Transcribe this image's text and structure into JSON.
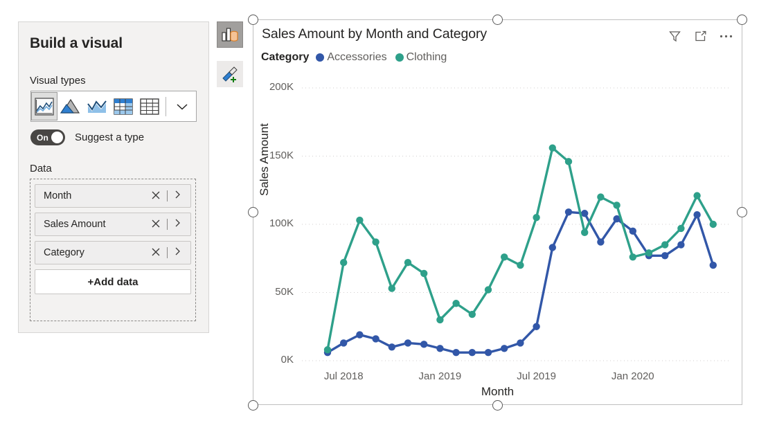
{
  "build_pane": {
    "title": "Build a visual",
    "visual_types_label": "Visual types",
    "visual_types": [
      {
        "name": "line-chart",
        "selected": true
      },
      {
        "name": "area-chart",
        "selected": false
      },
      {
        "name": "line-area-chart",
        "selected": false
      },
      {
        "name": "matrix-table",
        "selected": false
      },
      {
        "name": "table",
        "selected": false
      }
    ],
    "more_types_icon": "chevron-down-icon",
    "suggest": {
      "toggle_state": "On",
      "label": "Suggest a type"
    },
    "data_label": "Data",
    "fields": [
      {
        "name": "Month",
        "remove_icon": "close-icon",
        "expand_icon": "chevron-right-icon"
      },
      {
        "name": "Sales Amount",
        "remove_icon": "close-icon",
        "expand_icon": "chevron-right-icon"
      },
      {
        "name": "Category",
        "remove_icon": "close-icon",
        "expand_icon": "chevron-right-icon"
      }
    ],
    "add_data_label": "+Add data"
  },
  "side_buttons": [
    {
      "name": "build-visual-button",
      "icon": "bar-chart-data-icon",
      "active": true
    },
    {
      "name": "format-visual-button",
      "icon": "paintbrush-plus-icon",
      "active": false
    }
  ],
  "visual": {
    "header_icons": [
      "filter-icon",
      "focus-mode-icon",
      "more-options-icon"
    ],
    "colors": {
      "accessories": "#3257A8",
      "clothing": "#2EA08A",
      "gridline": "#d0cece",
      "text": "#605e5c"
    }
  },
  "chart_data": {
    "type": "line",
    "title": "Sales Amount by Month and Category",
    "xlabel": "Month",
    "ylabel": "Sales Amount",
    "legend_title": "Category",
    "legend_position": "top-left",
    "grid": true,
    "ylim": [
      0,
      200000
    ],
    "ytick_values": [
      0,
      50000,
      100000,
      150000,
      200000
    ],
    "ytick_labels": [
      "0K",
      "50K",
      "100K",
      "150K",
      "200K"
    ],
    "xtick_labels": [
      "Jul 2018",
      "Jan 2019",
      "Jul 2019",
      "Jan 2020"
    ],
    "xtick_indices": [
      1,
      7,
      13,
      19
    ],
    "x": [
      "Jun 2018",
      "Jul 2018",
      "Aug 2018",
      "Sep 2018",
      "Oct 2018",
      "Nov 2018",
      "Dec 2018",
      "Jan 2019",
      "Feb 2019",
      "Mar 2019",
      "Apr 2019",
      "May 2019",
      "Jun 2019",
      "Jul 2019",
      "Aug 2019",
      "Sep 2019",
      "Oct 2019",
      "Nov 2019",
      "Dec 2019",
      "Jan 2020",
      "Feb 2020",
      "Mar 2020",
      "Apr 2020",
      "May 2020",
      "Jun 2020"
    ],
    "series": [
      {
        "name": "Accessories",
        "color": "#3257A8",
        "values": [
          6000,
          13000,
          19000,
          16000,
          10000,
          13000,
          12000,
          9000,
          6000,
          6000,
          6000,
          9000,
          13000,
          25000,
          83000,
          109000,
          108000,
          87000,
          104000,
          95000,
          77000,
          77000,
          85000,
          107000,
          70000
        ]
      },
      {
        "name": "Clothing",
        "color": "#2EA08A",
        "values": [
          8000,
          72000,
          103000,
          87000,
          53000,
          72000,
          64000,
          30000,
          42000,
          34000,
          52000,
          76000,
          70000,
          105000,
          156000,
          146000,
          94000,
          120000,
          114000,
          76000,
          79000,
          85000,
          97000,
          121000,
          100000
        ]
      }
    ]
  }
}
